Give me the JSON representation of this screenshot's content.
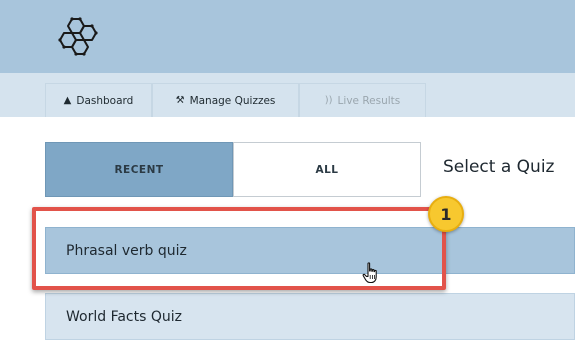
{
  "nav": {
    "dashboard": {
      "label": "Dashboard",
      "icon": "home-icon"
    },
    "manage_quizzes": {
      "label": "Manage Quizzes",
      "icon": "wrench-icon"
    },
    "live_results": {
      "label": "Live Results",
      "icon": "broadcast-icon"
    }
  },
  "filters": {
    "recent_label": "RECENT",
    "all_label": "ALL",
    "selected": "RECENT"
  },
  "main": {
    "title": "Select a Quiz"
  },
  "quizzes": [
    {
      "name": "Phrasal verb quiz"
    },
    {
      "name": "World Facts Quiz"
    }
  ],
  "annotation": {
    "step_number": "1"
  },
  "colors": {
    "header_bg": "#a8c5dc",
    "navbar_bg": "#d5e3ee",
    "selected_filter": "#7fa7c6",
    "highlight": "#e2534a",
    "badge": "#f7c82f"
  }
}
